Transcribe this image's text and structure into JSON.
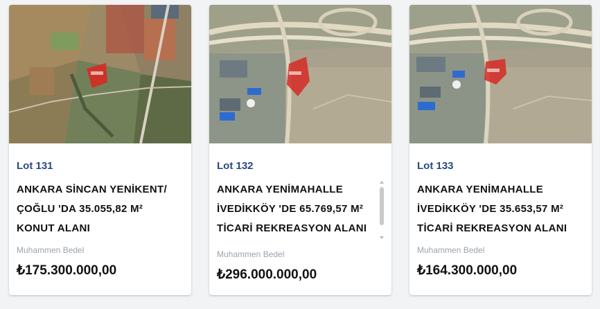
{
  "price_label": "Muhammen Bedel",
  "cards": [
    {
      "lot": "Lot 131",
      "title_lines": [
        "ANKARA SİNCAN YENİKENT/",
        "ÇOĞLU 'DA 35.055,82 M²",
        "KONUT ALANI"
      ],
      "price_label": "Muhammen Bedel",
      "price": "₺175.300.000,00",
      "image_alt": "aerial-map-parcel"
    },
    {
      "lot": "Lot 132",
      "title_lines": [
        "ANKARA YENİMAHALLE",
        "İVEDİKKÖY 'DE 65.769,57 M²",
        "TİCARİ REKREASYON ALANI"
      ],
      "price_label": "Muhammen Bedel",
      "price": "₺296.000.000,00",
      "image_alt": "aerial-map-parcel"
    },
    {
      "lot": "Lot 133",
      "title_lines": [
        "ANKARA YENİMAHALLE",
        "İVEDİKKÖY 'DE 35.653,57 M²",
        "TİCARİ REKREASYON ALANI"
      ],
      "price_label": "Muhammen Bedel",
      "price": "₺164.300.000,00",
      "image_alt": "aerial-map-parcel"
    }
  ],
  "colors": {
    "lot": "#2a4a7f",
    "title": "#111111",
    "price_label": "#9aa3ad",
    "parcel": "#d52a24"
  }
}
